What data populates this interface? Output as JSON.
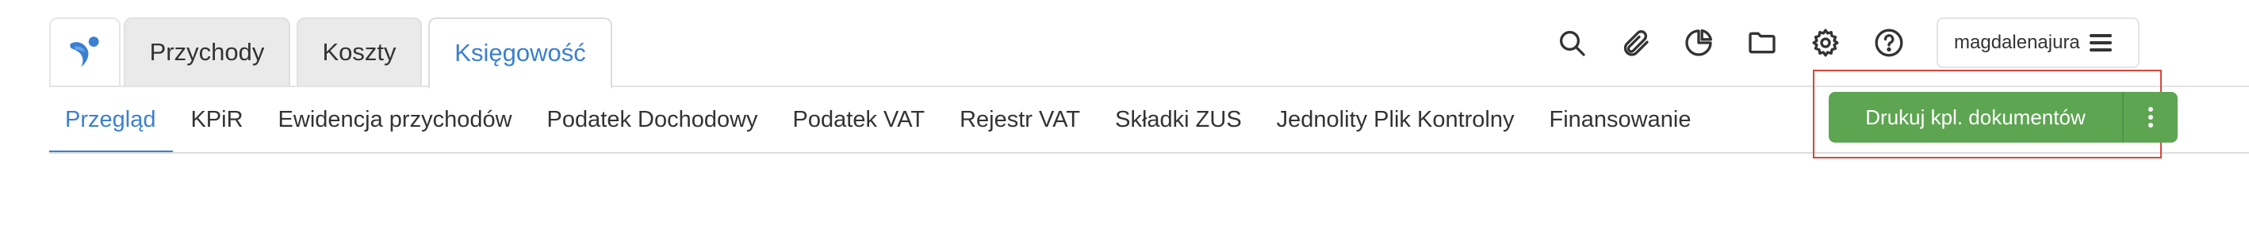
{
  "header": {
    "logo_icon": "brand-logo-icon",
    "tabs": [
      {
        "label": "Przychody",
        "active": false
      },
      {
        "label": "Koszty",
        "active": false
      },
      {
        "label": "Księgowość",
        "active": true
      }
    ],
    "icons": [
      "search-icon",
      "paperclip-icon",
      "pie-chart-icon",
      "folder-icon",
      "gear-icon",
      "help-icon"
    ],
    "user": {
      "name": "magdalenajura",
      "menu_icon": "hamburger-icon"
    }
  },
  "subnav": {
    "items": [
      {
        "label": "Przegląd",
        "active": true
      },
      {
        "label": "KPiR",
        "active": false
      },
      {
        "label": "Ewidencja przychodów",
        "active": false
      },
      {
        "label": "Podatek Dochodowy",
        "active": false
      },
      {
        "label": "Podatek VAT",
        "active": false
      },
      {
        "label": "Rejestr VAT",
        "active": false
      },
      {
        "label": "Składki ZUS",
        "active": false
      },
      {
        "label": "Jednolity Plik Kontrolny",
        "active": false
      },
      {
        "label": "Finansowanie",
        "active": false
      }
    ]
  },
  "actions": {
    "primary_label": "Drukuj kpl. dokumentów",
    "more_icon": "more-vertical-icon"
  },
  "colors": {
    "accent": "#3b80d0",
    "button": "#5ea552",
    "highlight": "#d6473b"
  }
}
